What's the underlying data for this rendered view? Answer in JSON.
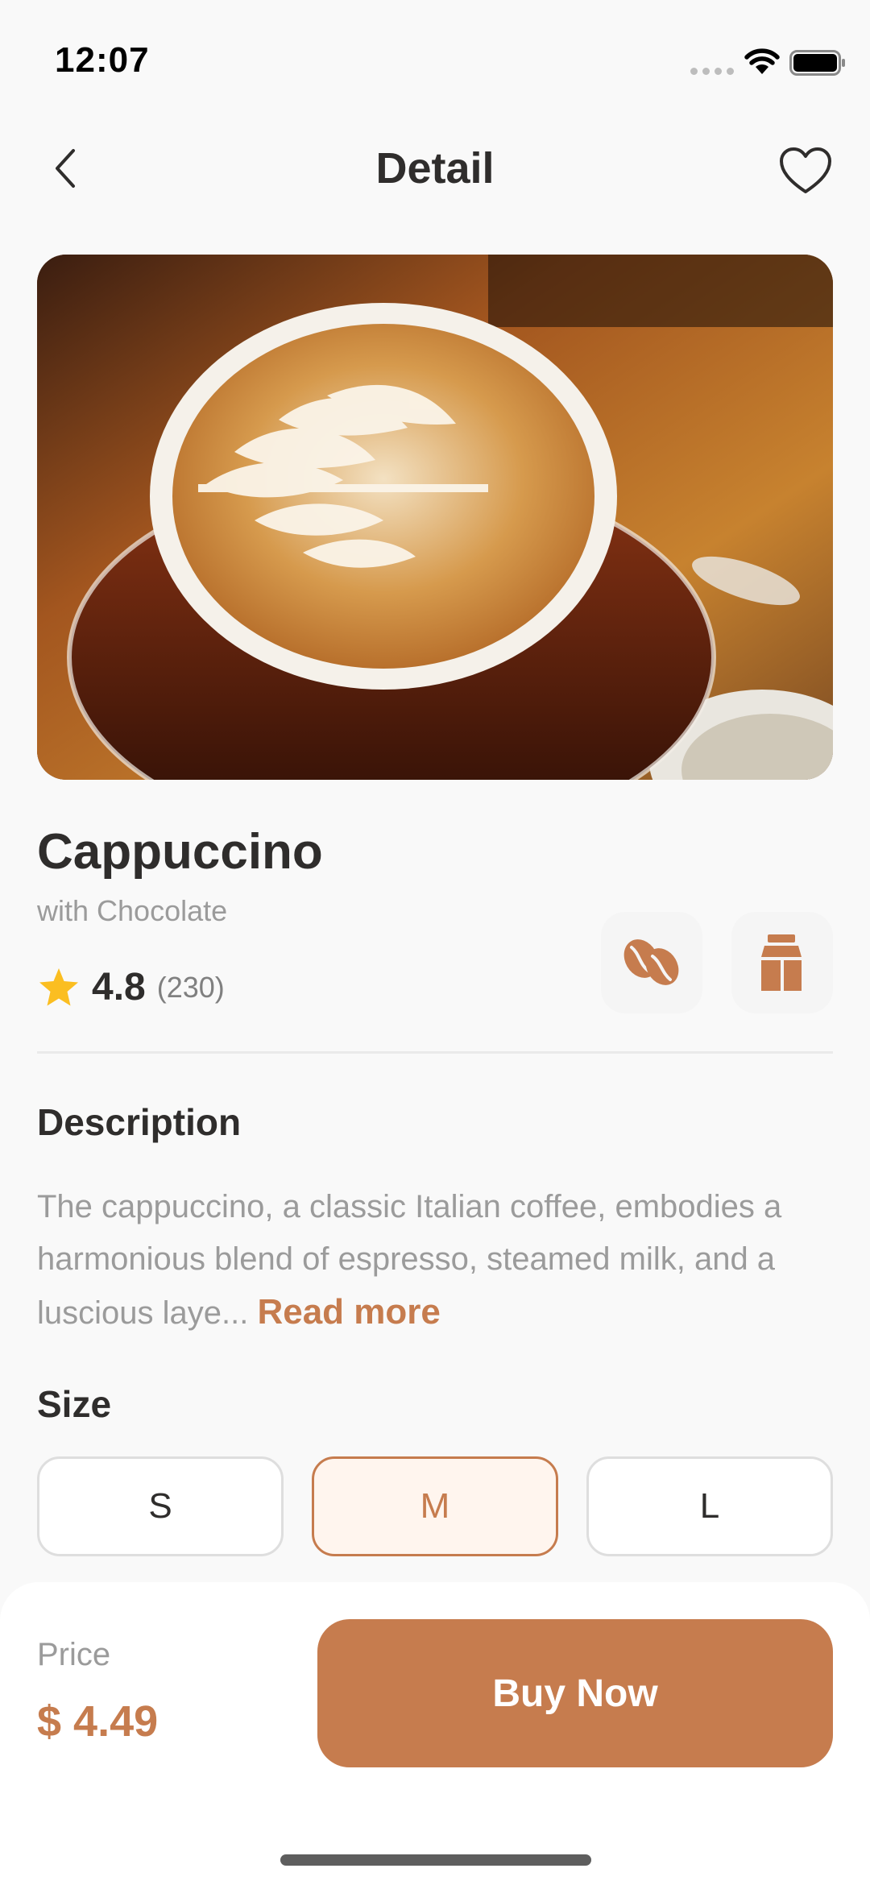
{
  "status_bar": {
    "time": "12:07"
  },
  "header": {
    "title": "Detail",
    "back_icon": "chevron-left-icon",
    "favorite_icon": "heart-outline-icon"
  },
  "hero": {
    "image_subject": "cappuccino with latte art"
  },
  "product": {
    "name": "Cappuccino",
    "subtitle": "with Chocolate",
    "rating": "4.8",
    "rating_count": "(230)",
    "feature_icons": [
      "coffee-bean-icon",
      "milk-carton-icon"
    ]
  },
  "description": {
    "heading": "Description",
    "text": "The cappuccino, a classic Italian coffee, embodies a harmonious blend of espresso, steamed milk, and a luscious laye...",
    "read_more": "Read more"
  },
  "size": {
    "heading": "Size",
    "options": [
      "S",
      "M",
      "L"
    ],
    "selected": "M"
  },
  "purchase": {
    "price_label": "Price",
    "price": "$ 4.49",
    "buy_label": "Buy Now"
  },
  "colors": {
    "accent": "#C67C4E",
    "accent_light": "#FFF5EE",
    "star": "#FBBE21",
    "text_dark": "#2F2D2C",
    "text_muted": "#9B9B9B"
  }
}
